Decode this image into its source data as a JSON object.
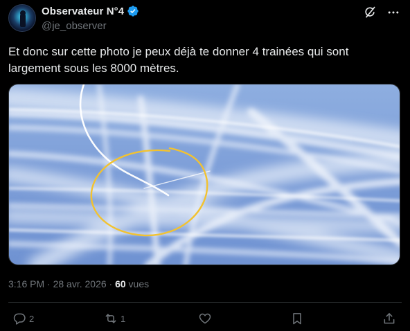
{
  "author": {
    "display_name": "Observateur N°4",
    "handle": "@je_observer",
    "verified_icon": "verified-badge-icon",
    "avatar_colors": [
      "#5fd6e8",
      "#1b3d66",
      "#050a18"
    ]
  },
  "header_icons": [
    "grok-icon",
    "more-icon"
  ],
  "tweet": {
    "text": "Et donc sur cette photo je peux déjà te donner 4 trainées qui sont largement sous les 8000 mètres."
  },
  "media": {
    "description_icon": "photo",
    "sky_color": "#7d9ed8",
    "annotation_color": "#f2c230"
  },
  "meta": {
    "time_date": "3:16 PM · 28 avr. 2026 · ",
    "views_count": "60",
    "views_label": " vues"
  },
  "actions": {
    "reply_count": "2",
    "repost_count": "1",
    "like_count": "",
    "bookmark_count": "",
    "share_count": ""
  },
  "colors": {
    "background": "#000000",
    "text_primary": "#e7e9ea",
    "text_secondary": "#71767b",
    "verified": "#1d9bf0",
    "border": "#2f3336"
  }
}
